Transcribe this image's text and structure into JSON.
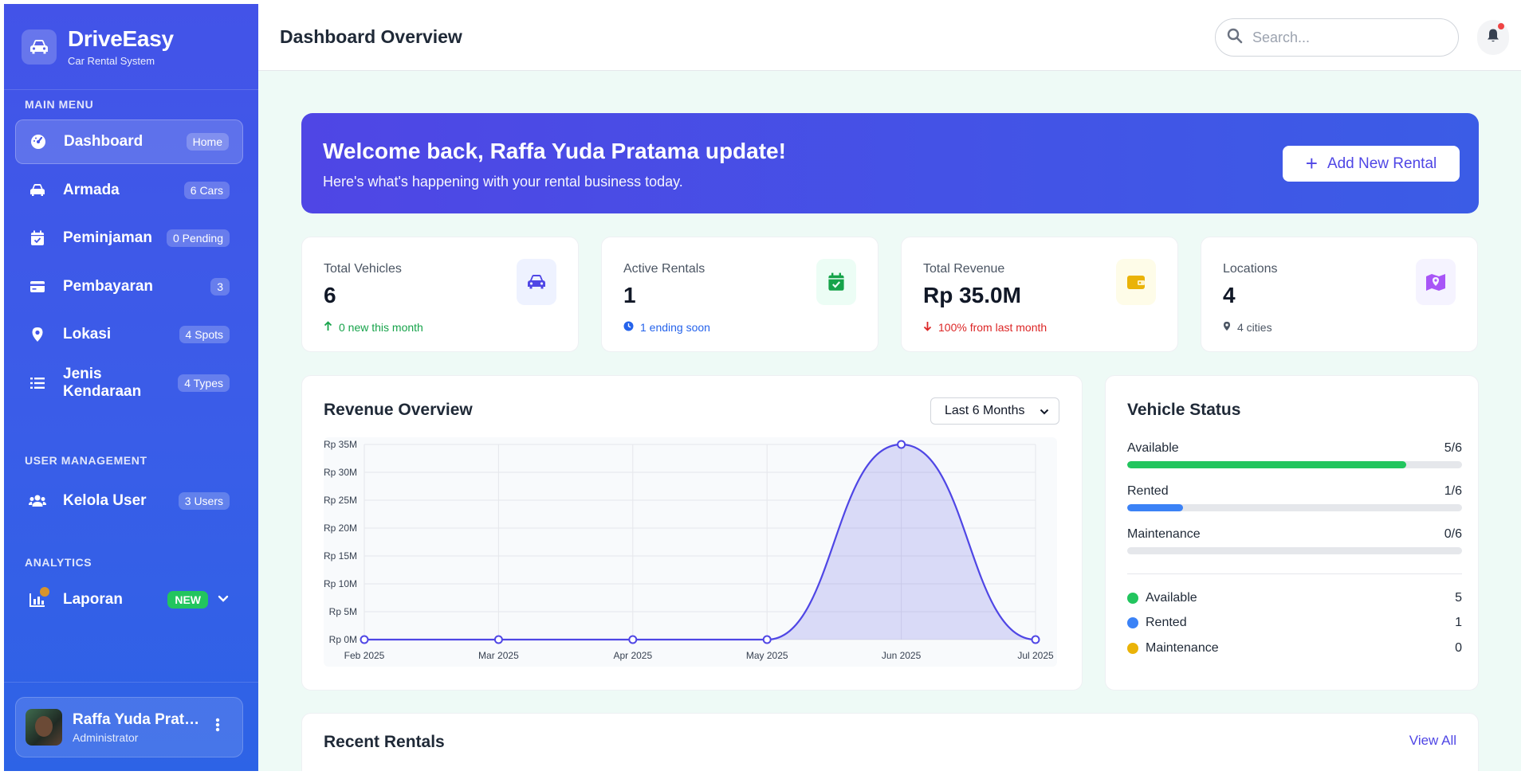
{
  "brand": {
    "name": "DriveEasy",
    "subtitle": "Car Rental System"
  },
  "sidebar": {
    "sections": {
      "main": "MAIN MENU",
      "user": "USER MANAGEMENT",
      "analytics": "ANALYTICS"
    },
    "items": [
      {
        "label": "Dashboard",
        "badge": "Home",
        "icon": "gauge-icon",
        "active": true
      },
      {
        "label": "Armada",
        "badge": "6 Cars",
        "icon": "car-icon"
      },
      {
        "label": "Peminjaman",
        "badge": "0 Pending",
        "icon": "calendar-check-icon"
      },
      {
        "label": "Pembayaran",
        "badge": "3",
        "icon": "credit-card-icon"
      },
      {
        "label": "Lokasi",
        "badge": "4 Spots",
        "icon": "map-pin-icon"
      },
      {
        "label": "Jenis Kendaraan",
        "badge": "4 Types",
        "icon": "list-icon"
      },
      {
        "label": "Kelola User",
        "badge": "3 Users",
        "icon": "users-icon"
      },
      {
        "label": "Laporan",
        "badge": "NEW",
        "icon": "chart-icon"
      }
    ],
    "profile": {
      "name": "Raffa Yuda Pratama",
      "role": "Administrator"
    }
  },
  "header": {
    "title": "Dashboard Overview",
    "search_placeholder": "Search..."
  },
  "welcome": {
    "title": "Welcome back, Raffa Yuda Pratama update!",
    "subtitle": "Here's what's happening with your rental business today.",
    "button": "Add New Rental"
  },
  "stats": [
    {
      "label": "Total Vehicles",
      "value": "6",
      "foot": "0 new this month",
      "color": "#16a34a"
    },
    {
      "label": "Active Rentals",
      "value": "1",
      "foot": "1 ending soon",
      "color": "#2563eb"
    },
    {
      "label": "Total Revenue",
      "value": "Rp 35.0M",
      "foot": "100% from last month",
      "color": "#dc2626"
    },
    {
      "label": "Locations",
      "value": "4",
      "foot": "4 cities",
      "color": "#4b5563"
    }
  ],
  "revenue": {
    "title": "Revenue Overview",
    "range": "Last 6 Months"
  },
  "chart_data": {
    "type": "area",
    "x": [
      "Feb 2025",
      "Mar 2025",
      "Apr 2025",
      "May 2025",
      "Jun 2025",
      "Jul 2025"
    ],
    "series": [
      {
        "values": [
          0,
          0,
          0,
          0,
          35,
          0
        ]
      }
    ],
    "yticks": [
      "Rp 0M",
      "Rp 5M",
      "Rp 10M",
      "Rp 15M",
      "Rp 20M",
      "Rp 25M",
      "Rp 30M",
      "Rp 35M"
    ],
    "ylim": [
      0,
      35
    ],
    "grid": true,
    "color": "#4f46e5"
  },
  "vehicle_status": {
    "title": "Vehicle Status",
    "bars": [
      {
        "label": "Available",
        "value": "5/6",
        "fraction": 0.833,
        "color": "#22c55e"
      },
      {
        "label": "Rented",
        "value": "1/6",
        "fraction": 0.167,
        "color": "#3b82f6"
      },
      {
        "label": "Maintenance",
        "value": "0/6",
        "fraction": 0,
        "color": "#eab308"
      }
    ],
    "legend": [
      {
        "label": "Available",
        "count": "5",
        "color": "#22c55e"
      },
      {
        "label": "Rented",
        "count": "1",
        "color": "#3b82f6"
      },
      {
        "label": "Maintenance",
        "count": "0",
        "color": "#eab308"
      }
    ]
  },
  "recent": {
    "title": "Recent Rentals",
    "view_all": "View All"
  }
}
